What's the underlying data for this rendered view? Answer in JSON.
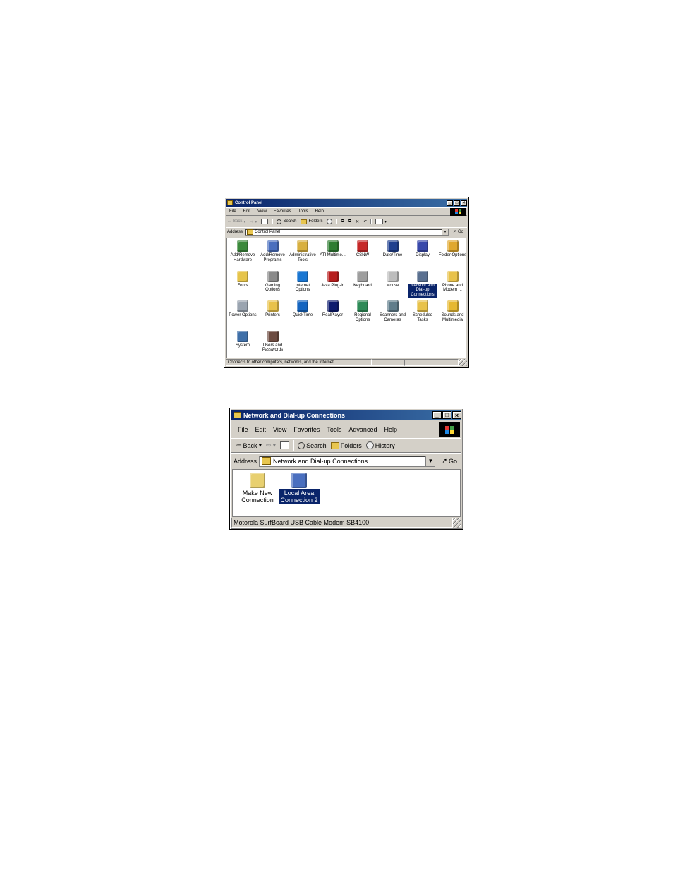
{
  "control_panel": {
    "title": "Control Panel",
    "menu": [
      "File",
      "Edit",
      "View",
      "Favorites",
      "Tools",
      "Help"
    ],
    "toolbar": {
      "back": "Back",
      "search": "Search",
      "folders": "Folders"
    },
    "address_label": "Address",
    "address_value": "Control Panel",
    "go_label": "Go",
    "icons": [
      {
        "label": "Add/Remove Hardware",
        "icon": "hardware-icon",
        "color": "#3c8a3c"
      },
      {
        "label": "Add/Remove Programs",
        "icon": "programs-icon",
        "color": "#4a6fbf"
      },
      {
        "label": "Administrative Tools",
        "icon": "admin-tools-icon",
        "color": "#d8b040"
      },
      {
        "label": "ATI Multime...",
        "icon": "ati-icon",
        "color": "#2e7d32"
      },
      {
        "label": "CSNW",
        "icon": "csnw-icon",
        "color": "#c62828"
      },
      {
        "label": "Date/Time",
        "icon": "calendar-icon",
        "color": "#1f3f8f"
      },
      {
        "label": "Display",
        "icon": "display-icon",
        "color": "#3949ab"
      },
      {
        "label": "Folder Options",
        "icon": "folder-options-icon",
        "color": "#e0a82e"
      },
      {
        "label": "Fonts",
        "icon": "fonts-icon",
        "color": "#e6c44a"
      },
      {
        "label": "Gaming Options",
        "icon": "joystick-icon",
        "color": "#8a8a8a"
      },
      {
        "label": "Internet Options",
        "icon": "globe-icon",
        "color": "#1976d2"
      },
      {
        "label": "Java Plug-in",
        "icon": "java-icon",
        "color": "#b71c1c"
      },
      {
        "label": "Keyboard",
        "icon": "keyboard-icon",
        "color": "#9e9e9e"
      },
      {
        "label": "Mouse",
        "icon": "mouse-icon",
        "color": "#bdbdbd"
      },
      {
        "label": "Network and Dial-up Connections",
        "icon": "network-icon",
        "color": "#5a7090",
        "selected": true
      },
      {
        "label": "Phone and Modem ...",
        "icon": "phone-icon",
        "color": "#e8c24a"
      },
      {
        "label": "Power Options",
        "icon": "power-icon",
        "color": "#9aa4b0"
      },
      {
        "label": "Printers",
        "icon": "printers-icon",
        "color": "#e8c24a"
      },
      {
        "label": "QuickTime",
        "icon": "quicktime-icon",
        "color": "#1565c0"
      },
      {
        "label": "RealPlayer",
        "icon": "realplayer-icon",
        "color": "#0d1b6e"
      },
      {
        "label": "Regional Options",
        "icon": "globe-icon",
        "color": "#2e8b57"
      },
      {
        "label": "Scanners and Cameras",
        "icon": "scanner-icon",
        "color": "#607d8b"
      },
      {
        "label": "Scheduled Tasks",
        "icon": "scheduled-tasks-icon",
        "color": "#e8c24a"
      },
      {
        "label": "Sounds and Multimedia",
        "icon": "speaker-icon",
        "color": "#e6b830"
      },
      {
        "label": "System",
        "icon": "computer-icon",
        "color": "#3f6fa8"
      },
      {
        "label": "Users and Passwords",
        "icon": "users-icon",
        "color": "#6d4c41"
      }
    ],
    "status_text": "Connects to other computers, networks, and the Internet"
  },
  "network": {
    "title": "Network and Dial-up Connections",
    "menu": [
      "File",
      "Edit",
      "View",
      "Favorites",
      "Tools",
      "Advanced",
      "Help"
    ],
    "toolbar": {
      "back": "Back",
      "search": "Search",
      "folders": "Folders",
      "history": "History"
    },
    "address_label": "Address",
    "address_value": "Network and Dial-up Connections",
    "go_label": "Go",
    "icons": [
      {
        "label": "Make New Connection",
        "icon": "new-connection-icon",
        "color": "#e8d070"
      },
      {
        "label": "Local Area Connection 2",
        "icon": "lan-icon",
        "color": "#4a6fbf",
        "selected": true
      }
    ],
    "status_text": "Motorola SurfBoard USB Cable Modem SB4100"
  },
  "colors": {
    "title_bar": "#0a246a",
    "chrome": "#d4d0c8",
    "selection": "#0a246a"
  }
}
